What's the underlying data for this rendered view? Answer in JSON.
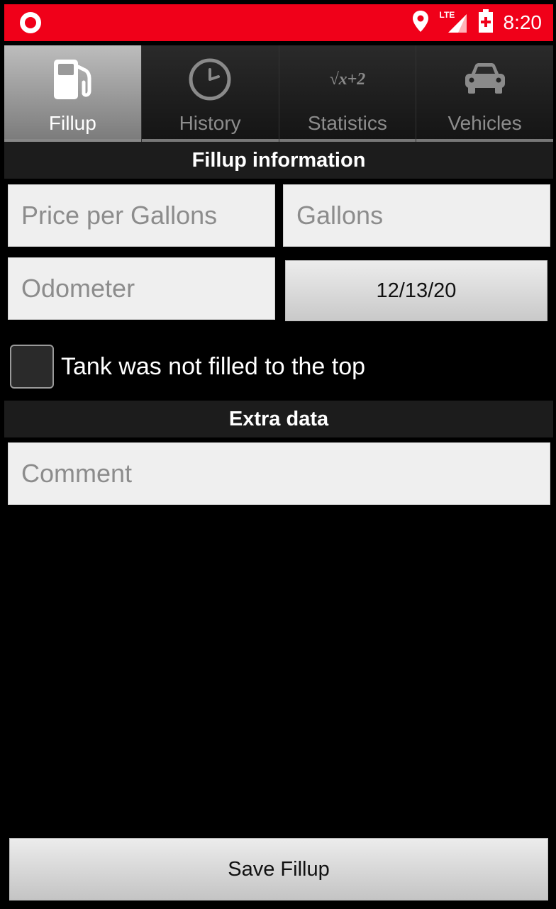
{
  "status_bar": {
    "time": "8:20",
    "network": "LTE",
    "icons": [
      "notification-dot-icon",
      "location-pin-icon",
      "lte-signal-icon",
      "battery-charging-icon"
    ],
    "color": "#f00019"
  },
  "tabs": [
    {
      "label": "Fillup",
      "icon": "gas-pump-icon",
      "active": true
    },
    {
      "label": "History",
      "icon": "clock-icon",
      "active": false
    },
    {
      "label": "Statistics",
      "icon": "sqrt-formula-icon",
      "active": false
    },
    {
      "label": "Vehicles",
      "icon": "car-icon",
      "active": false
    }
  ],
  "fillup_section": {
    "title": "Fillup information",
    "price_placeholder": "Price per Gallons",
    "gallons_placeholder": "Gallons",
    "odometer_placeholder": "Odometer",
    "date": "12/13/20",
    "not_full_label": "Tank was not filled to the top"
  },
  "extra_section": {
    "title": "Extra data",
    "comment_placeholder": "Comment"
  },
  "save_label": "Save Fillup",
  "statistics_icon_text": "√x+2"
}
